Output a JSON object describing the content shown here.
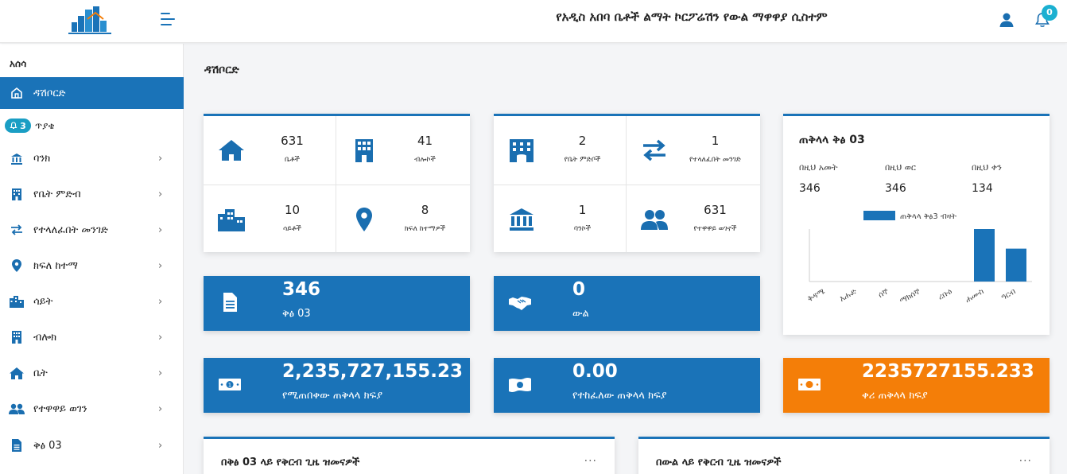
{
  "header": {
    "title": "የአዲስ አበባ ቤቶች ልማት ኮርፖሬሽን የውል ማዋዋያ ሲስተም",
    "notification_count": "0",
    "icons": [
      "logo-icon",
      "hamburger-icon",
      "user-icon",
      "bell-icon"
    ]
  },
  "sidebar": {
    "heading": "አሰሳ",
    "notifications": {
      "count": "3",
      "label": "ጥያቄ"
    },
    "items": [
      {
        "label": "ዳሽቦርድ",
        "icon": "home-outline-icon",
        "active": true
      },
      {
        "label": "ባንክ",
        "icon": "bank-icon"
      },
      {
        "label": "የቤት ምድብ",
        "icon": "building-icon"
      },
      {
        "label": "የተላለፈበት መንገድ",
        "icon": "exchange-icon"
      },
      {
        "label": "ክፍለ ከተማ",
        "icon": "location-pin-icon"
      },
      {
        "label": "ሳይት",
        "icon": "city-icon"
      },
      {
        "label": "ብሎክ",
        "icon": "building-icon"
      },
      {
        "label": "ቤት",
        "icon": "house-icon"
      },
      {
        "label": "የተዋዋይ ወገን",
        "icon": "users-icon"
      },
      {
        "label": "ቅፅ 03",
        "icon": "document-icon"
      }
    ]
  },
  "main": {
    "page_title": "ዳሽቦርድ",
    "stat_card_1": [
      {
        "value": "631",
        "caption": "ቤቶች",
        "icon": "house-icon"
      },
      {
        "value": "41",
        "caption": "ብሎኮች",
        "icon": "building-icon"
      },
      {
        "value": "10",
        "caption": "ሳይቶች",
        "icon": "city-icon"
      },
      {
        "value": "8",
        "caption": "ክፍለ ከተማዎች",
        "icon": "location-pin-icon"
      }
    ],
    "stat_card_2": [
      {
        "value": "2",
        "caption": "የቤት ምድቦች",
        "icon": "hotel-icon"
      },
      {
        "value": "1",
        "caption": "የተላለፈበት መንገድ",
        "icon": "exchange-icon"
      },
      {
        "value": "1",
        "caption": "ባንኮች",
        "icon": "bank-icon"
      },
      {
        "value": "631",
        "caption": "የተዋዋይ ወገኖች",
        "icon": "users-icon"
      }
    ],
    "tiles": [
      {
        "value": "346",
        "caption": "ቅፅ 03",
        "icon": "file-icon",
        "color": "#1a73b8"
      },
      {
        "value": "0",
        "caption": "ውል",
        "icon": "handshake-icon",
        "color": "#1a73b8"
      },
      {
        "value": "2,235,727,155.23",
        "caption": "የሚጠበቀው ጠቅላላ ክፍያ",
        "icon": "money-bill-icon",
        "color": "#1a73b8"
      },
      {
        "value": "0.00",
        "caption": "የተከፈለው ጠቅላላ ክፍያ",
        "icon": "money-bill-wave-icon",
        "color": "#1a73b8"
      },
      {
        "value": "2235727155.233",
        "caption": "ቀሪ ጠቅላላ ክፍያ",
        "icon": "money-bill-icon",
        "color": "#f47e08"
      }
    ],
    "summary": {
      "title": "ጠቅላላ ቅፅ 03",
      "periods": [
        {
          "label": "በዚህ አመት",
          "value": "346"
        },
        {
          "label": "በዚህ ወር",
          "value": "346"
        },
        {
          "label": "በዚህ ቀን",
          "value": "134"
        }
      ]
    },
    "bottom_cards": [
      {
        "title": "በቅፅ 03 ላይ የቅርብ ጊዜ ዝመናዎች",
        "more": "···"
      },
      {
        "title": "በውል ላይ የቅርብ ጊዜ ዝመናዎች",
        "more": "···"
      }
    ]
  },
  "chart_data": {
    "type": "bar",
    "legend": "ጠቅላላ ቅፅ3 ብዛት",
    "legend_position": "top",
    "categories": [
      "ቅዳሜ",
      "እሑድ",
      "ሰኞ",
      "ማክሰኞ",
      "ረቡዕ",
      "ሐሙስ",
      "ዓርብ"
    ],
    "series": [
      {
        "name": "ጠቅላላ ቅፅ3 ብዛት",
        "values": [
          0,
          0,
          0,
          0,
          0,
          134,
          84
        ]
      }
    ],
    "color": "#1a73b8",
    "ylim": [
      0,
      134
    ],
    "grid": false
  }
}
